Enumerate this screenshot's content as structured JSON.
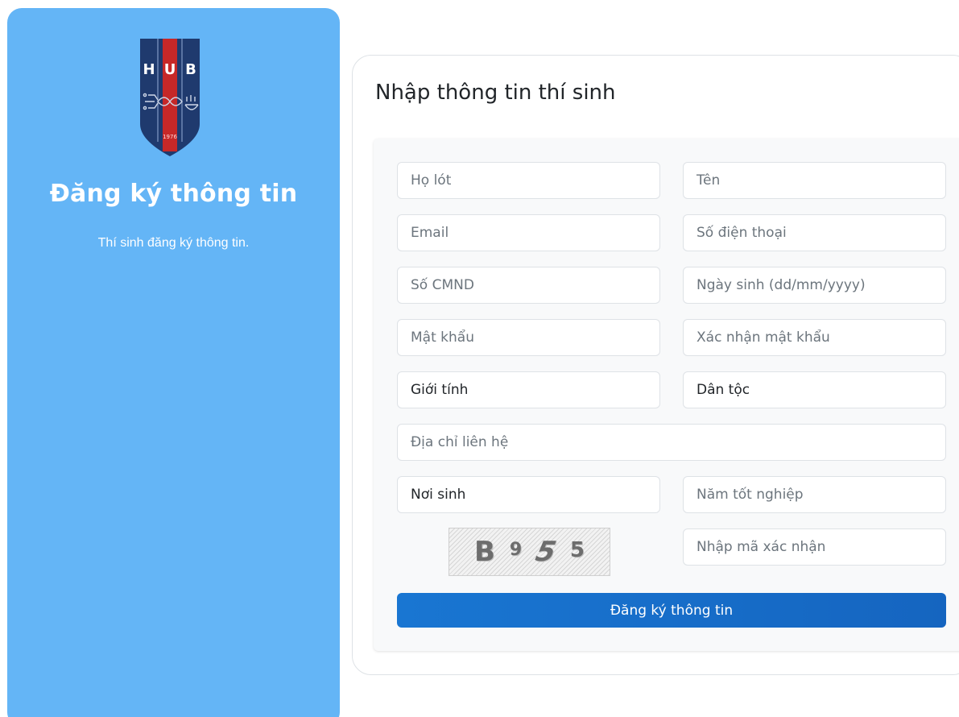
{
  "sidebar": {
    "logo_letters": [
      "H",
      "U",
      "B"
    ],
    "logo_year": "1976",
    "title": "Đăng ký thông tin",
    "subtitle": "Thí sinh đăng ký thông tin."
  },
  "form": {
    "title": "Nhập thông tin thí sinh",
    "fields": {
      "ho_lot": "Họ lót",
      "ten": "Tên",
      "email": "Email",
      "so_dien_thoai": "Số điện thoại",
      "so_cmnd": "Số CMND",
      "ngay_sinh": "Ngày sinh (dd/mm/yyyy)",
      "mat_khau": "Mật khẩu",
      "xac_nhan_mat_khau": "Xác nhận mật khẩu",
      "gioi_tinh": "Giới tính",
      "dan_toc": "Dân tộc",
      "dia_chi": "Địa chỉ liên hệ",
      "noi_sinh": "Nơi sinh",
      "nam_tot_nghiep": "Năm tốt nghiệp",
      "ma_xac_nhan": "Nhập mã xác nhận"
    },
    "captcha": [
      "B",
      "9",
      "5",
      "5"
    ],
    "submit_label": "Đăng ký thông tin"
  },
  "colors": {
    "sidebar_bg": "#64b5f6",
    "button_bg": "#1976d2",
    "logo_navy": "#1f3a6e",
    "logo_red": "#c62828"
  }
}
